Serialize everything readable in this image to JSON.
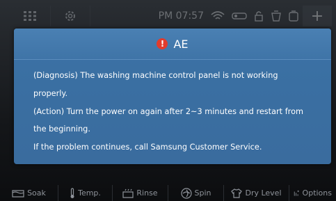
{
  "status_bar": {
    "time": "PM 07:57",
    "add_label": "+"
  },
  "dialog": {
    "title": "AE",
    "lines": [
      "(Diagnosis) The washing machine control panel is not working",
      "properly.",
      "(Action) Turn the power on again after 2~3 minutes and restart from",
      "the beginning.",
      "If the problem continues, call Samsung Customer Service."
    ]
  },
  "options_bar": {
    "items": [
      {
        "label": "Soak",
        "icon": "soak-icon"
      },
      {
        "label": "Temp.",
        "icon": "thermometer-icon"
      },
      {
        "label": "Rinse",
        "icon": "rinse-icon"
      },
      {
        "label": "Spin",
        "icon": "spin-icon"
      },
      {
        "label": "Dry Level",
        "icon": "shirt-icon"
      },
      {
        "label": "Options",
        "icon": "options-icon"
      }
    ]
  },
  "colors": {
    "dialog_bg": "#3a6fa2",
    "error_icon": "#e23b2c",
    "screen_bg": "#15171a"
  }
}
